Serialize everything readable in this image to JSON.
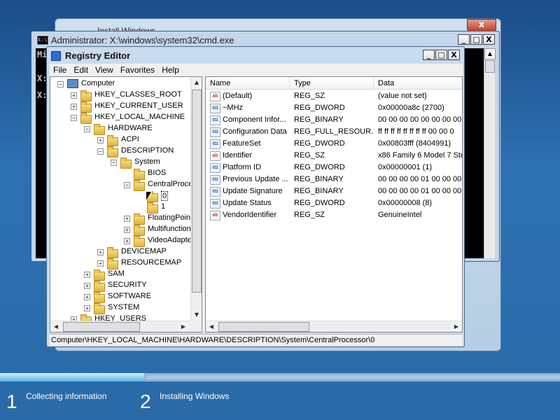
{
  "install_window": {
    "title": "Install Windows",
    "close_label": "x"
  },
  "cmd": {
    "title": "Administrator: X:\\windows\\system32\\cmd.exe",
    "lines": [
      "Mi",
      "X:",
      "X:"
    ],
    "min": "_",
    "max": "□",
    "close": "X"
  },
  "registry": {
    "title": "Registry Editor",
    "min": "_",
    "max": "□",
    "close": "X",
    "menu": [
      "File",
      "Edit",
      "View",
      "Favorites",
      "Help"
    ],
    "tree": [
      {
        "label": "Computer",
        "exp": "−",
        "icon": "pc"
      },
      {
        "label": "HKEY_CLASSES_ROOT",
        "exp": "+"
      },
      {
        "label": "HKEY_CURRENT_USER",
        "exp": "+"
      },
      {
        "label": "HKEY_LOCAL_MACHINE",
        "exp": "−"
      },
      {
        "label": "HARDWARE",
        "exp": "−"
      },
      {
        "label": "ACPI",
        "exp": "+"
      },
      {
        "label": "DESCRIPTION",
        "exp": "−"
      },
      {
        "label": "System",
        "exp": "−"
      },
      {
        "label": "BIOS",
        "exp": ""
      },
      {
        "label": "CentralProce",
        "exp": "−"
      },
      {
        "label": "0",
        "exp": "",
        "selected": true
      },
      {
        "label": "1",
        "exp": ""
      },
      {
        "label": "FloatingPoin",
        "exp": "+"
      },
      {
        "label": "Multifunction",
        "exp": "+"
      },
      {
        "label": "VideoAdapte",
        "exp": "+"
      },
      {
        "label": "DEVICEMAP",
        "exp": "+"
      },
      {
        "label": "RESOURCEMAP",
        "exp": "+"
      },
      {
        "label": "SAM",
        "exp": "+"
      },
      {
        "label": "SECURITY",
        "exp": "+"
      },
      {
        "label": "SOFTWARE",
        "exp": "+"
      },
      {
        "label": "SYSTEM",
        "exp": "+"
      },
      {
        "label": "HKEY_USERS",
        "exp": "+"
      }
    ],
    "columns": [
      "Name",
      "Type",
      "Data"
    ],
    "values": [
      {
        "icon": "sz",
        "name": "(Default)",
        "type": "REG_SZ",
        "data": "(value not set)"
      },
      {
        "icon": "bin",
        "name": "~MHz",
        "type": "REG_DWORD",
        "data": "0x00000a8c (2700)"
      },
      {
        "icon": "bin",
        "name": "Component Infor...",
        "type": "REG_BINARY",
        "data": "00 00 00 00 00 00 00 00 ("
      },
      {
        "icon": "bin",
        "name": "Configuration Data",
        "type": "REG_FULL_RESOUR...",
        "data": "ff ff ff ff ff ff ff ff 00 00 0"
      },
      {
        "icon": "bin",
        "name": "FeatureSet",
        "type": "REG_DWORD",
        "data": "0x00803fff (8404991)"
      },
      {
        "icon": "sz",
        "name": "Identifier",
        "type": "REG_SZ",
        "data": "x86 Family 6 Model 7 Step"
      },
      {
        "icon": "bin",
        "name": "Platform ID",
        "type": "REG_DWORD",
        "data": "0x00000001 (1)"
      },
      {
        "icon": "bin",
        "name": "Previous Update ...",
        "type": "REG_BINARY",
        "data": "00 00 00 00 01 00 00 00"
      },
      {
        "icon": "bin",
        "name": "Update Signature",
        "type": "REG_BINARY",
        "data": "00 00 00 00 01 00 00 00"
      },
      {
        "icon": "bin",
        "name": "Update Status",
        "type": "REG_DWORD",
        "data": "0x00000008 (8)"
      },
      {
        "icon": "sz",
        "name": "VendorIdentifier",
        "type": "REG_SZ",
        "data": "GenuineIntel"
      }
    ],
    "status": "Computer\\HKEY_LOCAL_MACHINE\\HARDWARE\\DESCRIPTION\\System\\CentralProcessor\\0"
  },
  "setup_steps": [
    {
      "number": "1",
      "label": "Collecting information"
    },
    {
      "number": "2",
      "label": "Installing Windows"
    }
  ]
}
